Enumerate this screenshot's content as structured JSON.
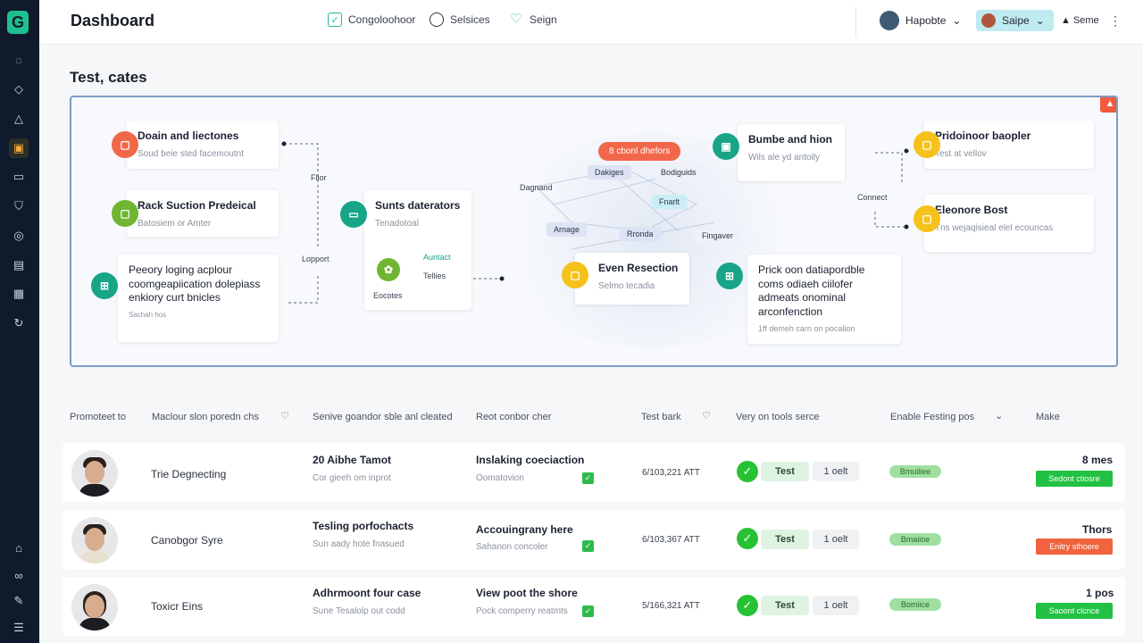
{
  "app": {
    "title": "Dashboard",
    "logo": "G"
  },
  "sidebar": {
    "icons": [
      "chat-icon",
      "tag-icon",
      "alert-icon",
      "briefcase-icon",
      "card-icon",
      "shield-icon",
      "target-icon",
      "file-icon",
      "grid-icon",
      "refresh-icon",
      "home-icon",
      "link-icon",
      "brush-icon",
      "menu-icon"
    ]
  },
  "header": {
    "nav": [
      {
        "label": "Congoloohoor",
        "icon": "check-square-icon",
        "color": "#25b7a3"
      },
      {
        "label": "Selsices",
        "icon": "globe-icon",
        "color": "#333333"
      },
      {
        "label": "Seign",
        "icon": "heart-icon",
        "color": "#2bb5a5"
      }
    ],
    "user": "Hapobte",
    "chip": "Saipe",
    "extra": "▲ Seme"
  },
  "section": {
    "title": "Test, cates"
  },
  "canvas": {
    "pill": "8 cbonl dhefors",
    "cards": [
      {
        "title": "Doain and liectones",
        "sub": "Soud beie sted facemoutnt"
      },
      {
        "title": "Rack Suction Predeical",
        "sub": "Batosiem or Amter"
      },
      {
        "title": "Peeory loging acplour coomgeapiication dolepiass enkiory curt bnicles",
        "sub": "Sachah hos"
      },
      {
        "title": "Sunts daterators",
        "sub": "Tenadotoal"
      },
      {
        "title": "Bumbe and hion",
        "sub": "Wils ale yd antoily"
      },
      {
        "title": "Pridoinoor baopler",
        "sub": "Test at vellov"
      },
      {
        "title": "Eleonore Bost",
        "sub": "Tns wejaqisieal elel ecouncas"
      },
      {
        "title": "Even Resection",
        "sub": "Selmo tecadia"
      },
      {
        "title": "Prick oon datiapordble coms odiaeh ciilofer admeats onominal arconfenction",
        "sub": "1ff demeh carn on pocalion"
      }
    ],
    "mini": {
      "a": "Auntact",
      "b": "Tellies",
      "c": "Eocotes"
    },
    "tags": [
      "Flior",
      "Lopport",
      "Dagnand",
      "Dakiges",
      "Bodiguids",
      "Fnarlt",
      "Arnage",
      "Rronda",
      "Fingaver",
      "Connect"
    ]
  },
  "table": {
    "headers": [
      "Promoteet to",
      "Maclour slon poredn chs",
      "Senive goandor sble anl cleated",
      "Reot conbor cher",
      "Test bark",
      "Very on tools serce",
      "Enable Festing pos",
      "Make"
    ],
    "rows": [
      {
        "name": "Trie Degnecting",
        "col2": "20 Aibhe Tamot",
        "col2s": "Cor gieeh om inprot",
        "col3": "Inslaking coeciaction",
        "col3s": "Oomatovion",
        "date": "6/103,221 ATT",
        "test": "Test",
        "count": "1 oelt",
        "status": "Bmuiliee",
        "make": "8 mes",
        "action": "Sedont ctiosre",
        "action_color": "#22c143"
      },
      {
        "name": "Canobgor Syre",
        "col2": "Tesling porfochacts",
        "col2s": "Sun aady hote fnasued",
        "col3": "Accouingrany here",
        "col3s": "Sahanon concoler",
        "date": "6/103,367 ATT",
        "test": "Test",
        "count": "1 oelt",
        "status": "Bmaiioe",
        "make": "Thors",
        "action": "Enitry sthoere",
        "action_color": "#f0633e"
      },
      {
        "name": "Toxicr Eins",
        "col2": "Adhrmoont four case",
        "col2s": "Sune Tesalolp out codd",
        "col3": "View poot the shore",
        "col3s": "Pock comperry reatmts",
        "date": "5/166,321 ATT",
        "test": "Test",
        "count": "1 oelt",
        "status": "Bomiice",
        "make": "1 pos",
        "action": "Saoont clcnce",
        "action_color": "#22c143"
      }
    ]
  }
}
